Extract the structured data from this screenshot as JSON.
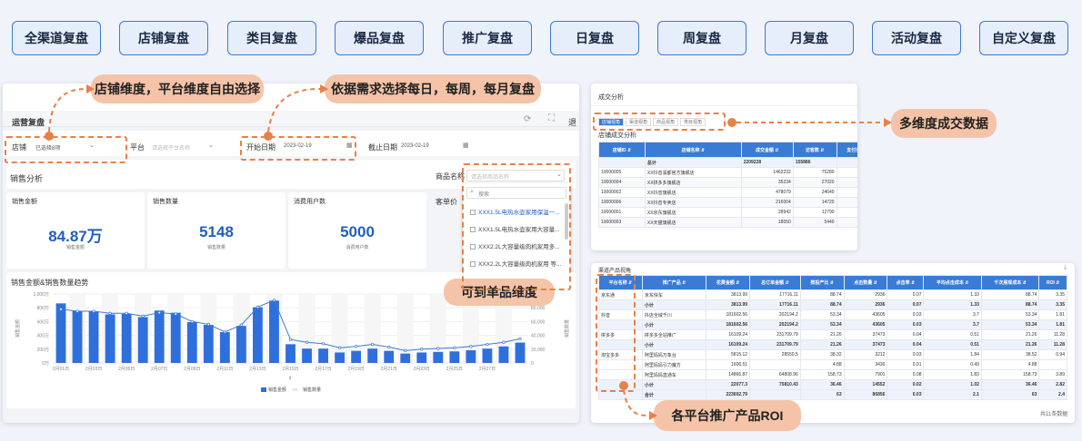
{
  "top_buttons": [
    "全渠道复盘",
    "店铺复盘",
    "类目复盘",
    "爆品复盘",
    "推广复盘",
    "日复盘",
    "周复盘",
    "月复盘",
    "活动复盘",
    "自定义复盘"
  ],
  "callouts": {
    "dimension": "店铺维度，平台维度自由选择",
    "dates": "依据需求选择每日，每周，每月复盘",
    "multi": "多维度成交数据",
    "single": "可到单品维度",
    "roi": "各平台推广产品ROI"
  },
  "left": {
    "title": "运营复盘",
    "filters": {
      "shop_label": "店铺",
      "shop_value": "已选择8项",
      "platform_label": "平台",
      "platform_ph": "请选择平台名称",
      "start_label": "开始日期",
      "start_value": "2023-02-19",
      "end_label": "截止日期",
      "end_value": "2023-02-19"
    },
    "section": "销售分析",
    "product_label": "商品名称",
    "product_ph": "请选择商品名称",
    "unit_price": "客单价",
    "search_ph": "搜索",
    "products": [
      "XXX1.5L电热水壶家用保温一...",
      "XXX1.5L电热水壶家用大容量...",
      "XXX2.2L大容量级肉机家用多...",
      "XXX2.2L大容量级肉机家用 等..."
    ],
    "kpis": [
      {
        "label": "销售金额",
        "value": "84.87万",
        "sub": "销售金额"
      },
      {
        "label": "销售数量",
        "value": "5148",
        "sub": "销售数量"
      },
      {
        "label": "消费用户数",
        "value": "5000",
        "sub": "消费用户数"
      }
    ],
    "chart_title": "销售金额&销售数量趋势",
    "ylabel": "销售金额",
    "y2label": "销售数量",
    "xlabel": "d",
    "legend": [
      "销售金额",
      "销售数量"
    ]
  },
  "chart_data": {
    "type": "bar",
    "ylim": [
      0,
      125000
    ],
    "y2lim": [
      0,
      100000
    ],
    "y_ticks": [
      "1,000万",
      "800万",
      "600万",
      "400万",
      "200万",
      "0万"
    ],
    "y2_ticks": [
      "100,000",
      "80,000",
      "60,000",
      "40,000",
      "20,000",
      "0"
    ],
    "x_ticks": [
      "2月01日",
      "2月03日",
      "2月05日",
      "2月07日",
      "2月09日",
      "2月11日",
      "2月13日",
      "2月15日",
      "2月17日",
      "2月19日",
      "2月21日",
      "2月23日",
      "2月25日",
      "2月27日"
    ],
    "series": [
      {
        "name": "销售金额",
        "values": [
          108000,
          94000,
          93000,
          88000,
          89000,
          83000,
          95000,
          91000,
          74000,
          69000,
          56000,
          67000,
          101000,
          113000,
          34000,
          26000,
          26000,
          19000,
          22000,
          26000,
          22000,
          17000,
          19000,
          20000,
          21000,
          23000,
          26000,
          30000,
          37000
        ]
      },
      {
        "name": "销售数量",
        "values": [
          78000,
          75000,
          75000,
          72000,
          72000,
          68000,
          73000,
          71000,
          60000,
          56000,
          45000,
          55000,
          81000,
          91000,
          34000,
          30000,
          28000,
          22000,
          24000,
          27000,
          23000,
          18000,
          20000,
          21000,
          22000,
          24000,
          27000,
          30000,
          35000
        ]
      }
    ]
  },
  "deal": {
    "title": "成交分析",
    "tabs": [
      "店铺视角",
      "渠道视角",
      "商品视角",
      "类目视角"
    ],
    "subtitle": "店铺成交分析",
    "headers": [
      "店铺ID ⇵",
      "店铺名称 ⇵",
      "成交金额 ⇵",
      "访客数 ⇵",
      "支付买"
    ],
    "total": [
      "",
      "总计",
      "2209228",
      "155886",
      ""
    ],
    "rows": [
      [
        "10000005",
        "XX抖音溪都官方旗舰店",
        "1462232",
        "75280"
      ],
      [
        "10000004",
        "XX拼多多旗舰店",
        "35234",
        "27020"
      ],
      [
        "10000002",
        "XX抖音旗舰店",
        "478079",
        "24640"
      ],
      [
        "10000006",
        "XX抖音专卖店",
        "216004",
        "14720"
      ],
      [
        "10000001",
        "XX京东旗舰店",
        "28942",
        "12790"
      ],
      [
        "10000003",
        "XX天猫旗舰店",
        "18050",
        "5440"
      ]
    ]
  },
  "promo": {
    "title": "渠道产品视角",
    "headers": [
      "平台名称 ⇵",
      "推广产品 ⇵",
      "花费金额 ⇵",
      "总订单金额 ⇵",
      "推投产比 ⇵",
      "点击数量 ⇵",
      "点击率 ⇵",
      "平均点击成本 ⇵",
      "千次展现成本 ⇵",
      "ROI ⇵"
    ],
    "rows": [
      [
        "京东通",
        "京东快车",
        "3813.99",
        "17716.11",
        "88.74",
        "2936",
        "0.07",
        "1.33",
        "88.74",
        "3.35"
      ],
      [
        "",
        "小计",
        "3813.99",
        "17716.11",
        "88.74",
        "2936",
        "0.07",
        "1.33",
        "88.74",
        "3.35"
      ],
      [
        "抖音",
        "抖店全域千川",
        "181602.56",
        "202194.2",
        "53.34",
        "43605",
        "0.03",
        "3.7",
        "53.34",
        "1.81"
      ],
      [
        "",
        "小计",
        "181602.56",
        "202194.2",
        "53.34",
        "43605",
        "0.03",
        "3.7",
        "53.34",
        "1.81"
      ],
      [
        "拼多多",
        "拼多多全站推广",
        "16109.24",
        "231709.79",
        "21.26",
        "37473",
        "0.04",
        "0.51",
        "21.26",
        "11.28"
      ],
      [
        "",
        "小计",
        "16109.24",
        "231709.79",
        "21.26",
        "37473",
        "0.04",
        "0.51",
        "21.26",
        "11.28"
      ],
      [
        "淘宝多多",
        "阿里妈妈万象台",
        "5815.12",
        "28550.5",
        "38.32",
        "3212",
        "0.03",
        "1.84",
        "38.52",
        "0.94"
      ],
      [
        "",
        "阿里妈妈引力魔方",
        "1606.51",
        "",
        "4.88",
        "3430",
        "0.01",
        "0.49",
        "4.88",
        ""
      ],
      [
        "",
        "阿里妈妈直通车",
        "14866.87",
        "64808.96",
        "158.73",
        "7901",
        "0.08",
        "1.83",
        "158.73",
        "3.89"
      ],
      [
        "",
        "小计",
        "22077.3",
        "75810.43",
        "36.46",
        "14552",
        "0.02",
        "1.02",
        "36.46",
        "2.82"
      ],
      [
        "",
        "合计",
        "223602.79",
        "",
        "63",
        "86856",
        "0.03",
        "2.1",
        "63",
        "2.4"
      ]
    ],
    "footer": "共11条数据"
  }
}
